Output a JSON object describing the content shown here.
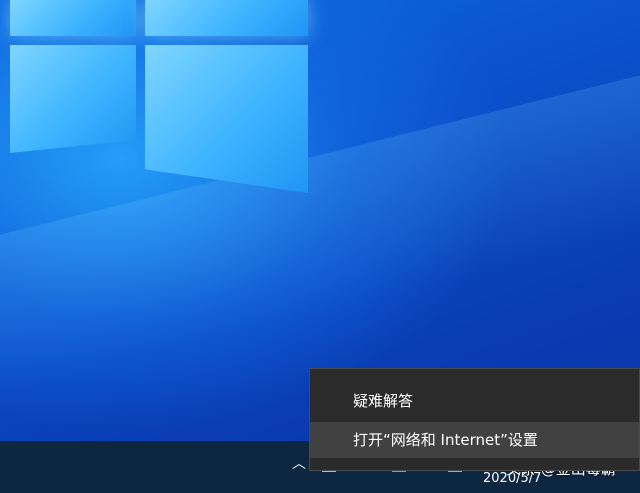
{
  "context_menu": {
    "items": [
      {
        "label": "疑难解答"
      },
      {
        "label": "打开“网络和 Internet”设置"
      }
    ]
  },
  "taskbar": {
    "tray_chevron": "︿",
    "date": "2020/5/7"
  },
  "watermark": {
    "text": "头条 @金山毒霸"
  },
  "colors": {
    "menu_bg": "#2b2b2b",
    "menu_hover": "#414141",
    "taskbar_bg": "#0e2740",
    "desktop_blue": "#0a3cb4"
  },
  "icons": [
    "windows-logo-icon",
    "network-icon",
    "volume-icon",
    "input-method-icon",
    "chevron-up-icon"
  ]
}
